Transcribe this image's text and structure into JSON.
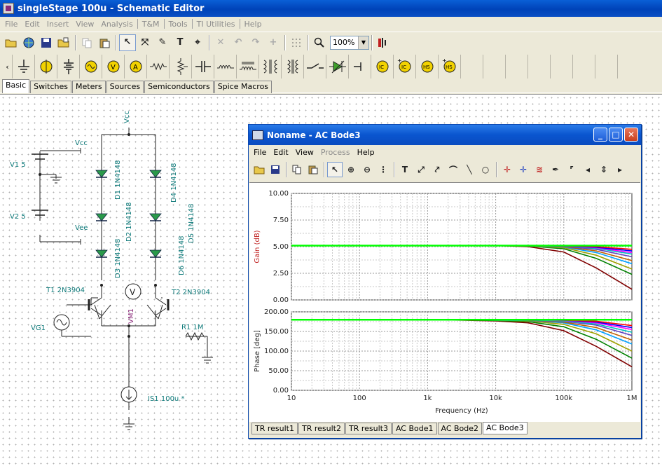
{
  "window": {
    "title": "singleStage 100u - Schematic Editor"
  },
  "menu": [
    "File",
    "Edit",
    "Insert",
    "View",
    "Analysis",
    "T&M",
    "Tools",
    "TI Utilities",
    "Help"
  ],
  "toolbar": {
    "zoom": "100%"
  },
  "component_tabs": [
    "Basic",
    "Switches",
    "Meters",
    "Sources",
    "Semiconductors",
    "Spice Macros"
  ],
  "schematic": {
    "labels": {
      "vcc_top": "Vcc",
      "vcc_left": "Vcc",
      "vee": "Vee",
      "v1": "V1 5",
      "v2": "V2 5",
      "d1": "D1 1N4148",
      "d2": "D2 1N4148",
      "d3": "D3 1N4148",
      "d4": "D4 1N4148",
      "d5": "D5 1N4148",
      "d6": "D6 1N4148",
      "t1": "T1 2N3904",
      "t2": "T2 2N3904",
      "vm1": "VM1",
      "vg1": "VG1",
      "r1": "R1 1M",
      "is1": "IS1 100u *",
      "meter_symbol": "V"
    }
  },
  "bode_window": {
    "title": "Noname - AC Bode3",
    "menu": [
      {
        "label": "File",
        "enabled": true
      },
      {
        "label": "Edit",
        "enabled": true
      },
      {
        "label": "View",
        "enabled": true
      },
      {
        "label": "Process",
        "enabled": false
      },
      {
        "label": "Help",
        "enabled": true
      }
    ],
    "result_tabs": [
      "TR result1",
      "TR result2",
      "TR result3",
      "AC Bode1",
      "AC Bode2",
      "AC Bode3"
    ],
    "selected_tab": "AC Bode3"
  },
  "chart_data": [
    {
      "type": "line",
      "ylabel": "Gain (dB)",
      "xlabel": "",
      "xscale": "log",
      "xlim": [
        10,
        1000000
      ],
      "ylim": [
        0,
        10
      ],
      "yticks": [
        "0.00",
        "2.50",
        "5.00",
        "7.50",
        "10.00"
      ],
      "grid": true,
      "x": [
        10,
        100,
        1000,
        10000,
        30000,
        100000,
        300000,
        1000000
      ],
      "series": [
        {
          "color": "#00ff00",
          "values": [
            5.1,
            5.1,
            5.1,
            5.1,
            5.1,
            5.1,
            5.1,
            5.1
          ]
        },
        {
          "color": "#ff0000",
          "values": [
            5.1,
            5.1,
            5.1,
            5.1,
            5.1,
            5.08,
            5.0,
            4.75
          ]
        },
        {
          "color": "#0000ff",
          "values": [
            5.1,
            5.1,
            5.1,
            5.1,
            5.1,
            5.07,
            4.95,
            4.6
          ]
        },
        {
          "color": "#ff00ff",
          "values": [
            5.1,
            5.1,
            5.1,
            5.1,
            5.1,
            5.06,
            4.9,
            4.45
          ]
        },
        {
          "color": "#00c0c0",
          "values": [
            5.1,
            5.1,
            5.1,
            5.1,
            5.1,
            5.05,
            4.85,
            4.3
          ]
        },
        {
          "color": "#6040c0",
          "values": [
            5.1,
            5.1,
            5.1,
            5.1,
            5.1,
            5.03,
            4.75,
            4.05
          ]
        },
        {
          "color": "#c06000",
          "values": [
            5.1,
            5.1,
            5.1,
            5.1,
            5.09,
            5.0,
            4.6,
            3.7
          ]
        },
        {
          "color": "#00a0ff",
          "values": [
            5.1,
            5.1,
            5.1,
            5.1,
            5.08,
            4.97,
            4.45,
            3.4
          ]
        },
        {
          "color": "#a0a000",
          "values": [
            5.1,
            5.1,
            5.1,
            5.1,
            5.07,
            4.9,
            4.2,
            2.9
          ]
        },
        {
          "color": "#008000",
          "values": [
            5.1,
            5.1,
            5.1,
            5.1,
            5.06,
            4.8,
            3.9,
            2.4
          ]
        },
        {
          "color": "#800000",
          "values": [
            5.1,
            5.1,
            5.1,
            5.1,
            5.0,
            4.5,
            3.0,
            1.0
          ]
        }
      ]
    },
    {
      "type": "line",
      "ylabel": "Phase [deg]",
      "xlabel": "Frequency (Hz)",
      "xscale": "log",
      "xlim": [
        10,
        1000000
      ],
      "ylim": [
        0,
        200
      ],
      "xticks": [
        "10",
        "100",
        "1k",
        "10k",
        "100k",
        "1M"
      ],
      "yticks": [
        "0.00",
        "50.00",
        "100.00",
        "150.00",
        "200.00"
      ],
      "grid": true,
      "x": [
        10,
        100,
        1000,
        3000,
        10000,
        30000,
        100000,
        300000,
        1000000
      ],
      "series": [
        {
          "color": "#00ff00",
          "values": [
            180,
            180,
            180,
            180,
            180,
            180,
            180,
            180,
            180
          ]
        },
        {
          "color": "#ff0000",
          "values": [
            180,
            180,
            180,
            180,
            180,
            180,
            179,
            176,
            165
          ]
        },
        {
          "color": "#0000ff",
          "values": [
            180,
            180,
            180,
            180,
            180,
            180,
            178.5,
            174,
            160
          ]
        },
        {
          "color": "#ff00ff",
          "values": [
            180,
            180,
            180,
            180,
            180,
            180,
            178,
            172,
            155
          ]
        },
        {
          "color": "#00c0c0",
          "values": [
            180,
            180,
            180,
            180,
            180,
            179.5,
            177,
            169,
            148
          ]
        },
        {
          "color": "#6040c0",
          "values": [
            180,
            180,
            180,
            180,
            180,
            179,
            176,
            166,
            140
          ]
        },
        {
          "color": "#c06000",
          "values": [
            180,
            180,
            180,
            180,
            179.5,
            178.5,
            174,
            160,
            128
          ]
        },
        {
          "color": "#00a0ff",
          "values": [
            180,
            180,
            180,
            180,
            179,
            178,
            172,
            154,
            118
          ]
        },
        {
          "color": "#a0a000",
          "values": [
            180,
            180,
            180,
            180,
            179,
            177,
            168,
            144,
            100
          ]
        },
        {
          "color": "#008000",
          "values": [
            180,
            180,
            180,
            179.5,
            178,
            175,
            162,
            130,
            82
          ]
        },
        {
          "color": "#800000",
          "values": [
            180,
            180,
            180,
            179,
            177,
            172,
            152,
            112,
            60
          ]
        }
      ]
    }
  ]
}
